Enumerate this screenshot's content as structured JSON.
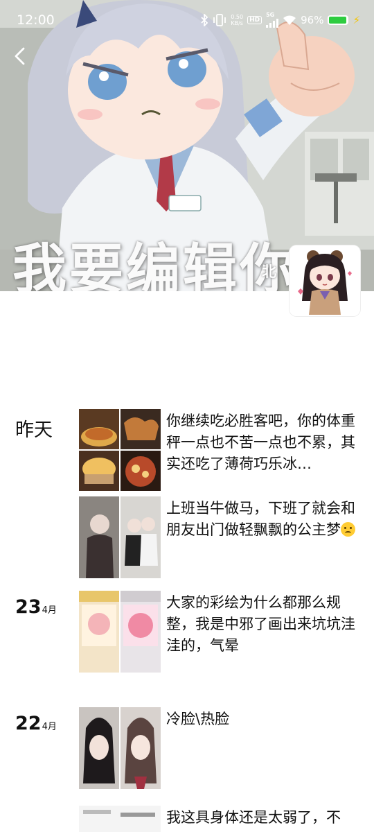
{
  "status_bar": {
    "time": "12:00",
    "net_speed_value": "0.50",
    "net_speed_unit": "KB/s",
    "hd_label": "HD",
    "network": "5G",
    "battery_text": "96%",
    "battery_level": 0.96,
    "battery_color": "#2ecc40"
  },
  "cover": {
    "caption": "我要编辑你"
  },
  "profile": {
    "name": "北"
  },
  "feed": [
    {
      "date_label": "昨天",
      "posts": [
        {
          "text": "你继续吃必胜客吧，你的体重秤一点也不苦一点也不累，其实还吃了薄荷巧乐冰…",
          "image_count": 4
        },
        {
          "text": "上班当牛做马，下班了就会和朋友出门做轻飘飘的公主梦",
          "emoji": "crying-face",
          "image_count": 2
        }
      ]
    },
    {
      "day": "23",
      "month": "4月",
      "posts": [
        {
          "text": "大家的彩绘为什么都那么规整，我是中邪了画出来坑坑洼洼的，气晕",
          "image_count": 2
        }
      ]
    },
    {
      "day": "22",
      "month": "4月",
      "posts": [
        {
          "text": "冷脸\\热脸",
          "image_count": 2
        },
        {
          "text": "我这具身体还是太弱了，不",
          "image_count": 1
        }
      ]
    }
  ],
  "icons": {
    "back": "chevron-left-icon",
    "bluetooth": "bluetooth-icon",
    "vibrate": "vibrate-icon",
    "signal": "signal-icon",
    "wifi": "wifi-icon",
    "battery": "battery-icon",
    "charging": "charging-bolt-icon"
  }
}
